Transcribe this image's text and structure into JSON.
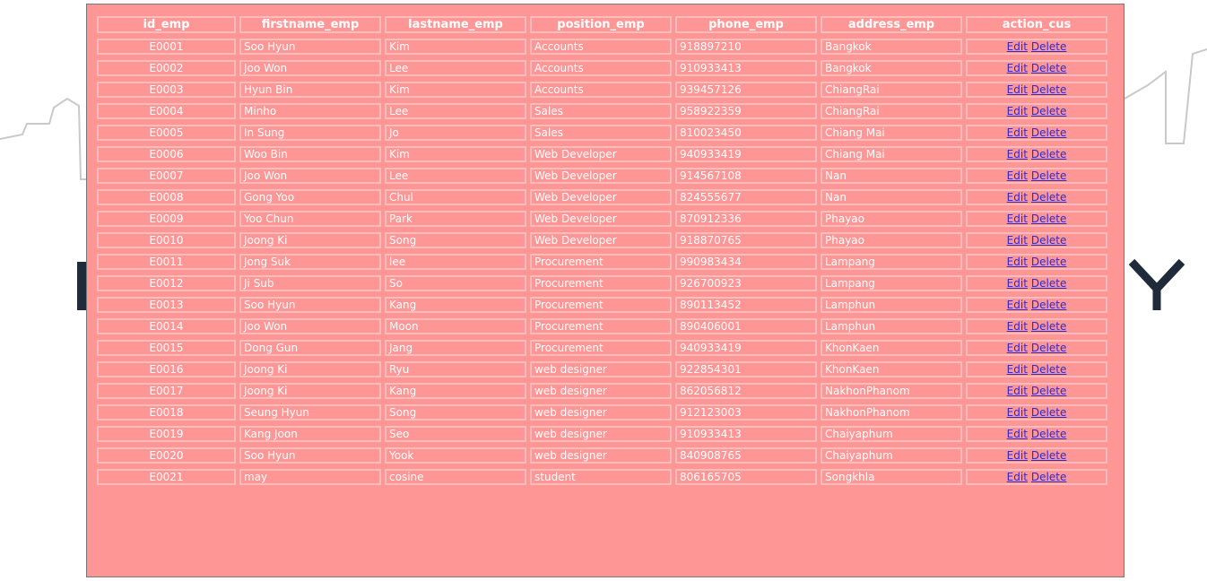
{
  "columns": [
    "id_emp",
    "firstname_emp",
    "lastname_emp",
    "position_emp",
    "phone_emp",
    "address_emp",
    "action_cus"
  ],
  "actions": {
    "edit": "Edit",
    "delete": "Delete"
  },
  "colors": {
    "table_bg": "#ff9696",
    "cell_border": "#ffbcbc",
    "text": "#ffffff",
    "link": "#2a2ad6"
  },
  "rows": [
    [
      "E0001",
      "Soo Hyun",
      "Kim",
      "Accounts",
      "918897210",
      "Bangkok"
    ],
    [
      "E0002",
      "Joo Won",
      "Lee",
      "Accounts",
      "910933413",
      "Bangkok"
    ],
    [
      "E0003",
      "Hyun Bin",
      "Kim",
      "Accounts",
      "939457126",
      "ChiangRai"
    ],
    [
      "E0004",
      "Minho",
      "Lee",
      "Sales",
      "958922359",
      "ChiangRai"
    ],
    [
      "E0005",
      "In Sung",
      "Jo",
      "Sales",
      "810023450",
      "Chiang Mai"
    ],
    [
      "E0006",
      "Woo Bin",
      "Kim",
      "Web Developer",
      "940933419",
      "Chiang Mai"
    ],
    [
      "E0007",
      "Joo Won",
      "Lee",
      "Web Developer",
      "914567108",
      "Nan"
    ],
    [
      "E0008",
      "Gong Yoo",
      "Chul",
      "Web Developer",
      "824555677",
      "Nan"
    ],
    [
      "E0009",
      "Yoo Chun",
      "Park",
      "Web Developer",
      "870912336",
      "Phayao"
    ],
    [
      "E0010",
      "Joong Ki",
      "Song",
      "Web Developer",
      "918870765",
      "Phayao"
    ],
    [
      "E0011",
      "Jong Suk",
      "lee",
      "Procurement",
      "990983434",
      "Lampang"
    ],
    [
      "E0012",
      "Ji Sub",
      "So",
      "Procurement",
      "926700923",
      "Lampang"
    ],
    [
      "E0013",
      "Soo Hyun",
      "Kang",
      "Procurement",
      "890113452",
      "Lamphun"
    ],
    [
      "E0014",
      "Joo Won",
      "Moon",
      "Procurement",
      "890406001",
      "Lamphun"
    ],
    [
      "E0015",
      "Dong Gun",
      "Jang",
      "Procurement",
      "940933419",
      "KhonKaen"
    ],
    [
      "E0016",
      "Joong Ki",
      "Ryu",
      "web designer",
      "922854301",
      "KhonKaen"
    ],
    [
      "E0017",
      "Joong Ki",
      "Kang",
      "web designer",
      "862056812",
      "NakhonPhanom"
    ],
    [
      "E0018",
      "Seung Hyun",
      "Song",
      "web designer",
      "912123003",
      "NakhonPhanom"
    ],
    [
      "E0019",
      "Kang Joon",
      "Seo",
      "web designer",
      "910933413",
      "Chaiyaphum"
    ],
    [
      "E0020",
      "Soo Hyun",
      "Yook",
      "web designer",
      "840908765",
      "Chaiyaphum"
    ],
    [
      "E0021",
      "may",
      "cosine",
      "student",
      "806165705",
      "Songkhla"
    ]
  ]
}
